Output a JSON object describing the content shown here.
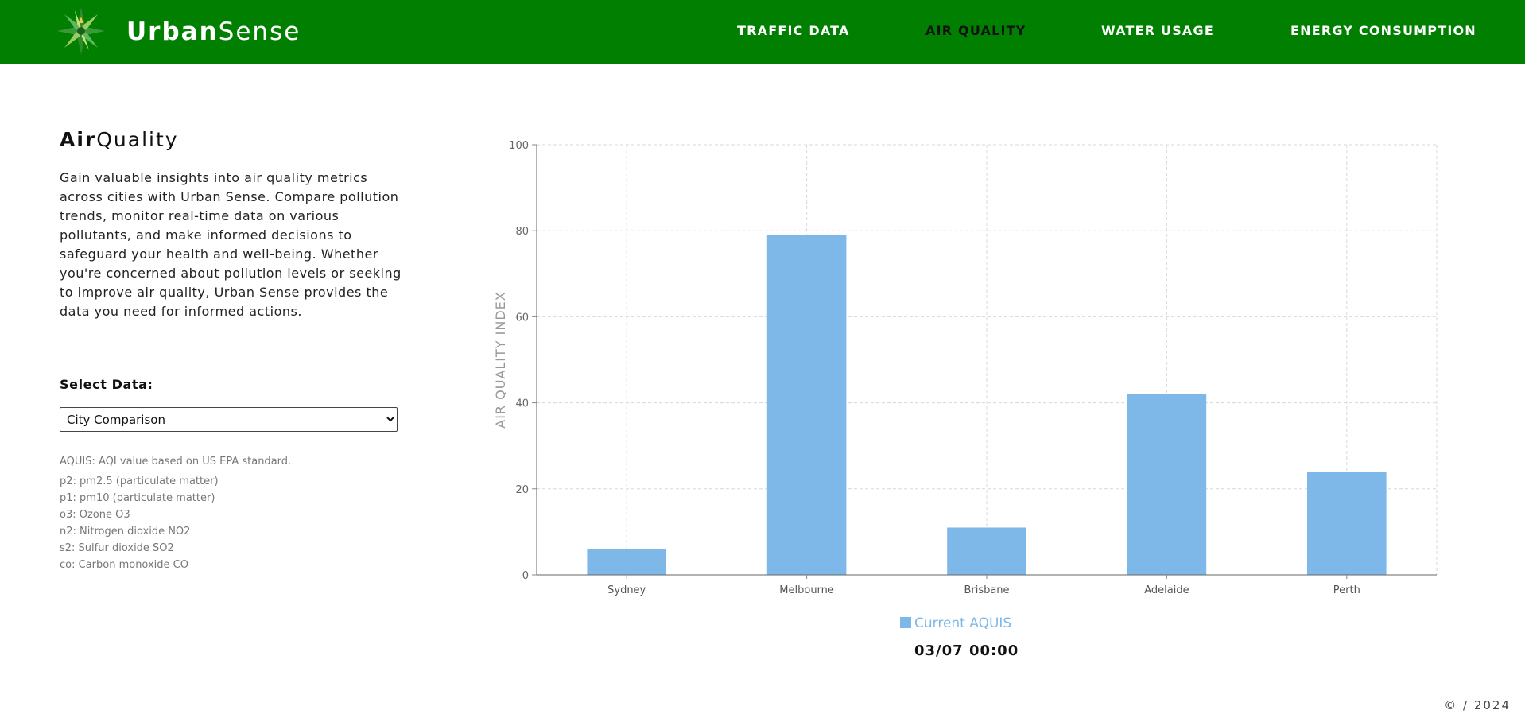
{
  "header": {
    "brand_bold": "Urban",
    "brand_light": "Sense",
    "nav": [
      {
        "label": "TRAFFIC DATA"
      },
      {
        "label": "AIR QUALITY"
      },
      {
        "label": "WATER USAGE"
      },
      {
        "label": "ENERGY CONSUMPTION"
      }
    ],
    "active_nav": "AIR QUALITY",
    "colors": {
      "bar": "#007f00",
      "active_text": "#111111",
      "text": "#ffffff"
    }
  },
  "sidebar": {
    "title_bold": "Air",
    "title_light": "Quality",
    "description": "Gain valuable insights into air quality metrics across cities with Urban Sense. Compare pollution trends, monitor real-time data on various pollutants, and make informed decisions to safeguard your health and well-being. Whether you're concerned about pollution levels or seeking to improve air quality, Urban Sense provides the data you need for informed actions.",
    "select_label": "Select Data:",
    "select_value": "City Comparison",
    "notes": [
      "AQUIS: AQI value based on US EPA standard.",
      "p2: pm2.5 (particulate matter)",
      "p1: pm10 (particulate matter)",
      "o3: Ozone O3",
      "n2: Nitrogen dioxide NO2",
      "s2: Sulfur dioxide SO2",
      "co: Carbon monoxide CO"
    ]
  },
  "chart_data": {
    "type": "bar",
    "categories": [
      "Sydney",
      "Melbourne",
      "Brisbane",
      "Adelaide",
      "Perth"
    ],
    "series": [
      {
        "name": "Current AQUIS",
        "values": [
          6,
          79,
          11,
          42,
          24
        ],
        "color": "#7db8e8"
      }
    ],
    "ylabel": "AIR QUALITY INDEX",
    "xlabel": "",
    "ylim": [
      0,
      100
    ],
    "yticks": [
      0,
      20,
      40,
      60,
      80,
      100
    ],
    "grid": true,
    "legend_position": "bottom"
  },
  "chart_footer": {
    "timestamp": "03/07 00:00"
  },
  "footer": {
    "text": "© / 2024"
  }
}
